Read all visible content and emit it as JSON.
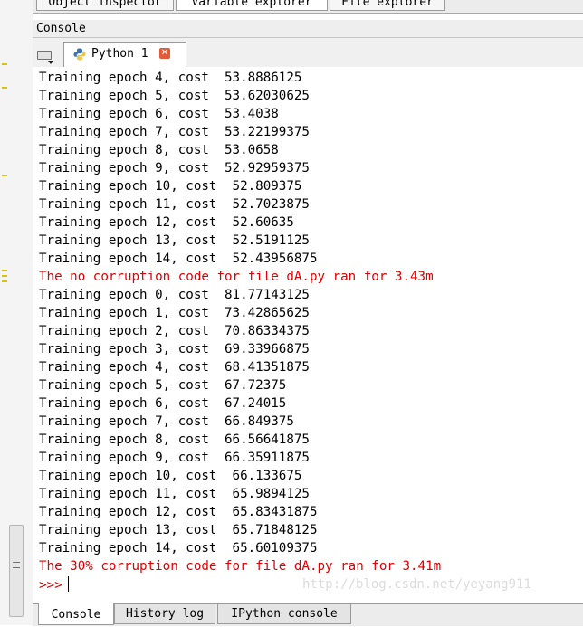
{
  "top_tabs": [
    {
      "label": "Object inspector"
    },
    {
      "label": "Variable explorer"
    },
    {
      "label": "File explorer"
    }
  ],
  "dock_title": "Console",
  "console_tab": {
    "label": "Python 1"
  },
  "output": [
    {
      "text": "Training epoch 4, cost  53.8886125",
      "kind": "normal"
    },
    {
      "text": "Training epoch 5, cost  53.62030625",
      "kind": "normal"
    },
    {
      "text": "Training epoch 6, cost  53.4038",
      "kind": "normal"
    },
    {
      "text": "Training epoch 7, cost  53.22199375",
      "kind": "normal"
    },
    {
      "text": "Training epoch 8, cost  53.0658",
      "kind": "normal"
    },
    {
      "text": "Training epoch 9, cost  52.92959375",
      "kind": "normal"
    },
    {
      "text": "Training epoch 10, cost  52.809375",
      "kind": "normal"
    },
    {
      "text": "Training epoch 11, cost  52.7023875",
      "kind": "normal"
    },
    {
      "text": "Training epoch 12, cost  52.60635",
      "kind": "normal"
    },
    {
      "text": "Training epoch 13, cost  52.5191125",
      "kind": "normal"
    },
    {
      "text": "Training epoch 14, cost  52.43956875",
      "kind": "normal"
    },
    {
      "text": "The no corruption code for file dA.py ran for 3.43m",
      "kind": "error"
    },
    {
      "text": "Training epoch 0, cost  81.77143125",
      "kind": "normal"
    },
    {
      "text": "Training epoch 1, cost  73.42865625",
      "kind": "normal"
    },
    {
      "text": "Training epoch 2, cost  70.86334375",
      "kind": "normal"
    },
    {
      "text": "Training epoch 3, cost  69.33966875",
      "kind": "normal"
    },
    {
      "text": "Training epoch 4, cost  68.41351875",
      "kind": "normal"
    },
    {
      "text": "Training epoch 5, cost  67.72375",
      "kind": "normal"
    },
    {
      "text": "Training epoch 6, cost  67.24015",
      "kind": "normal"
    },
    {
      "text": "Training epoch 7, cost  66.849375",
      "kind": "normal"
    },
    {
      "text": "Training epoch 8, cost  66.56641875",
      "kind": "normal"
    },
    {
      "text": "Training epoch 9, cost  66.35911875",
      "kind": "normal"
    },
    {
      "text": "Training epoch 10, cost  66.133675",
      "kind": "normal"
    },
    {
      "text": "Training epoch 11, cost  65.9894125",
      "kind": "normal"
    },
    {
      "text": "Training epoch 12, cost  65.83431875",
      "kind": "normal"
    },
    {
      "text": "Training epoch 13, cost  65.71848125",
      "kind": "normal"
    },
    {
      "text": "Training epoch 14, cost  65.60109375",
      "kind": "normal"
    },
    {
      "text": "The 30% corruption code for file dA.py ran for 3.41m",
      "kind": "error"
    }
  ],
  "prompt": ">>>",
  "watermark": "http://blog.csdn.net/yeyang911",
  "bottom_tabs": [
    {
      "label": "Console"
    },
    {
      "label": "History log"
    },
    {
      "label": "IPython console"
    }
  ],
  "colors": {
    "error": "#e00000",
    "normal": "#000000"
  }
}
